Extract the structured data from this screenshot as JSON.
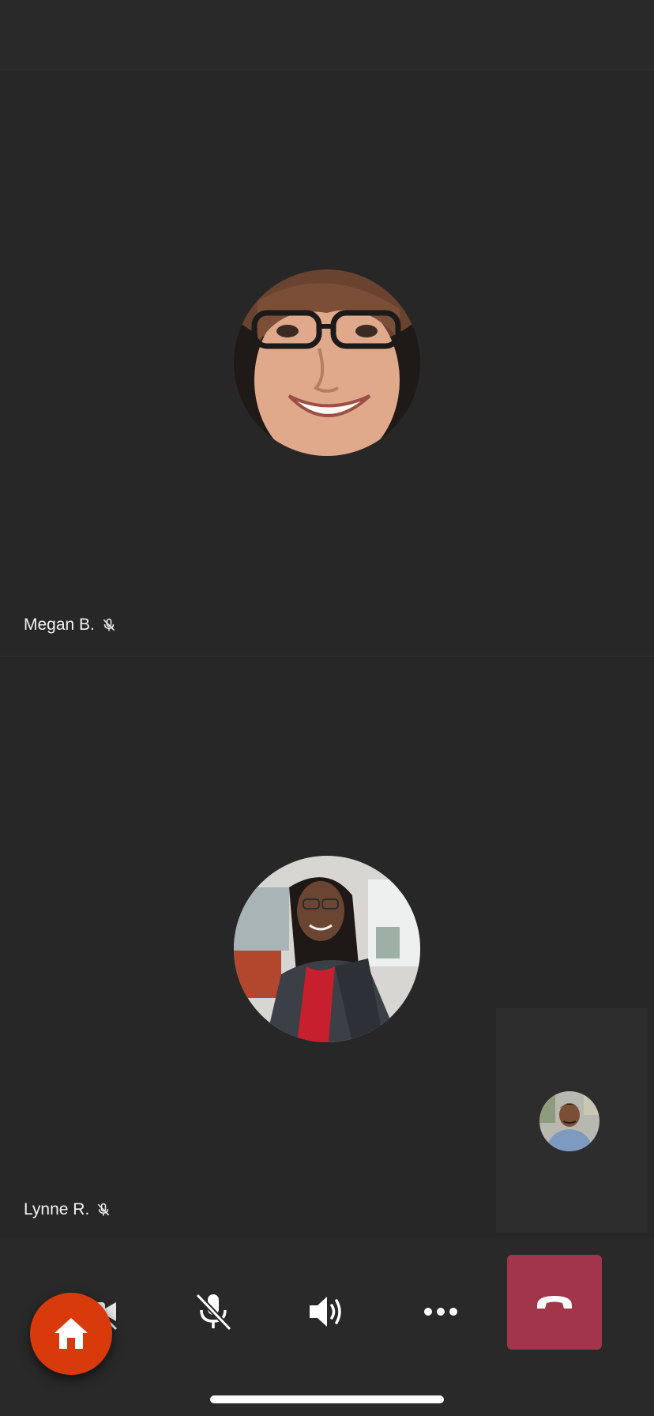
{
  "participants": [
    {
      "name": "Megan B.",
      "muted": true,
      "avatar_icon": "avatar-photo-woman-glasses"
    },
    {
      "name": "Lynne R.",
      "muted": true,
      "avatar_icon": "avatar-photo-woman-red-top"
    }
  ],
  "self_view": {
    "avatar_icon": "avatar-photo-man"
  },
  "controls": {
    "camera": {
      "icon": "video-off-icon",
      "state": "off"
    },
    "mic": {
      "icon": "mic-off-icon",
      "state": "muted"
    },
    "speaker": {
      "icon": "speaker-icon",
      "state": "on"
    },
    "more": {
      "icon": "more-options-icon"
    },
    "hangup": {
      "icon": "hang-up-icon",
      "color": "#a1364b"
    }
  },
  "home_fab": {
    "icon": "home-icon",
    "color": "#d93a0b"
  },
  "colors": {
    "background": "#292929",
    "tile": "#282728",
    "text": "#f2f2f2"
  }
}
